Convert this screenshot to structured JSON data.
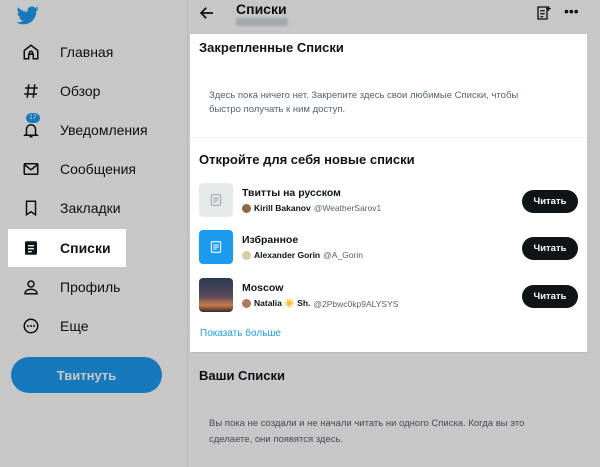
{
  "sidebar": {
    "items": [
      {
        "label": "Главная",
        "icon": "home-icon"
      },
      {
        "label": "Обзор",
        "icon": "hashtag-icon"
      },
      {
        "label": "Уведомления",
        "icon": "bell-icon",
        "badge": "17"
      },
      {
        "label": "Сообщения",
        "icon": "mail-icon"
      },
      {
        "label": "Закладки",
        "icon": "bookmark-icon"
      },
      {
        "label": "Списки",
        "icon": "lists-icon",
        "active": true
      },
      {
        "label": "Профиль",
        "icon": "profile-icon"
      },
      {
        "label": "Еще",
        "icon": "more-circle-icon"
      }
    ],
    "tweet_button": "Твитнуть"
  },
  "header": {
    "title": "Списки"
  },
  "pinned": {
    "title": "Закрепленные Списки",
    "empty_text": "Здесь пока ничего нет. Закрепите здесь свои любимые Списки, чтобы быстро получать к ним доступ."
  },
  "discover": {
    "title": "Откройте для себя новые списки",
    "lists": [
      {
        "name": "Твитты на русском",
        "owner_name": "Kirill Bakanov",
        "owner_handle": "@WeatherSarov1",
        "button": "Читать"
      },
      {
        "name": "Избранное",
        "owner_name": "Alexander Gorin",
        "owner_handle": "@A_Gorin",
        "button": "Читать"
      },
      {
        "name": "Moscow",
        "owner_name": "Natalia ☀️ Sh.",
        "owner_handle": "@2Pbwc0kp9ALYSYS",
        "button": "Читать"
      }
    ],
    "show_more": "Показать больше"
  },
  "yours": {
    "title": "Ваши Списки",
    "empty_text": "Вы пока не создали и не начали читать ни одного Списка. Когда вы это сделаете, они появятся здесь."
  },
  "colors": {
    "accent": "#1d9bf0",
    "text": "#0f1419",
    "muted": "#536471",
    "button_dark": "#0f1419"
  }
}
